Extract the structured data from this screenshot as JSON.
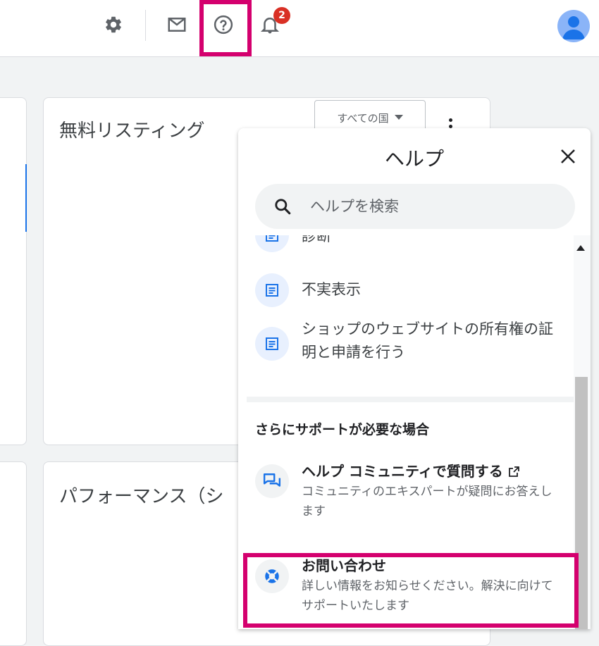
{
  "topbar": {
    "notifications_count": "2",
    "icons": [
      "gear-icon",
      "mail-icon",
      "help-icon",
      "bell-icon",
      "avatar"
    ]
  },
  "cards": {
    "free_listings_title": "無料リスティング",
    "country_select_value": "すべての国",
    "performance_title": "パフォーマンス（シ"
  },
  "help": {
    "title": "ヘルプ",
    "search_placeholder": "ヘルプを検索",
    "articles": [
      {
        "label": "診断"
      },
      {
        "label": "不実表示"
      },
      {
        "label": "ショップのウェブサイトの所有権の証明と申請を行う"
      }
    ],
    "more_support_heading": "さらにサポートが必要な場合",
    "community": {
      "title": "ヘルプ コミュニティで質問する",
      "description": "コミュニティのエキスパートが疑問にお答えします"
    },
    "contact": {
      "title": "お問い合わせ",
      "description": "詳しい情報をお知らせください。解決に向けてサポートいたします"
    }
  },
  "colors": {
    "highlight": "#d4006e",
    "badge": "#d93025",
    "link_blue": "#1a73e8"
  }
}
